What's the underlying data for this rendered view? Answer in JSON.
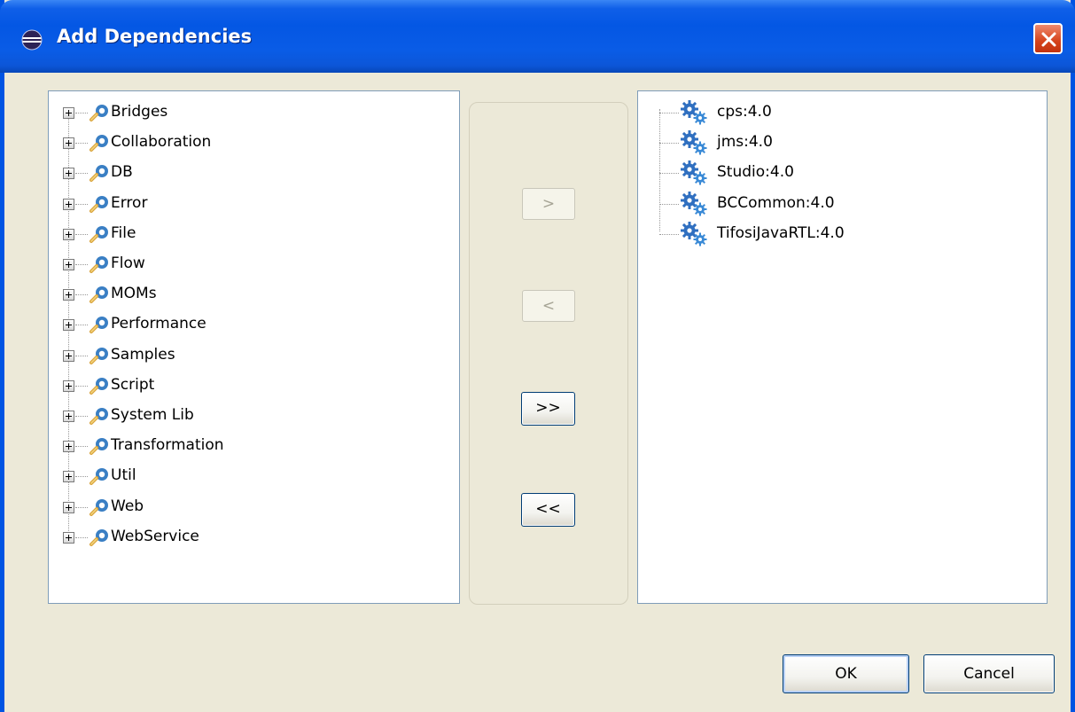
{
  "window": {
    "title": "Add Dependencies"
  },
  "left_tree": {
    "items": [
      {
        "label": "Bridges"
      },
      {
        "label": "Collaboration"
      },
      {
        "label": "DB"
      },
      {
        "label": "Error"
      },
      {
        "label": "File"
      },
      {
        "label": "Flow"
      },
      {
        "label": "MOMs"
      },
      {
        "label": "Performance"
      },
      {
        "label": "Samples"
      },
      {
        "label": "Script"
      },
      {
        "label": "System Lib"
      },
      {
        "label": "Transformation"
      },
      {
        "label": "Util"
      },
      {
        "label": "Web"
      },
      {
        "label": "WebService"
      }
    ],
    "icon": "package-icon"
  },
  "right_tree": {
    "items": [
      {
        "label": "cps:4.0"
      },
      {
        "label": "jms:4.0"
      },
      {
        "label": "Studio:4.0"
      },
      {
        "label": "BCCommon:4.0"
      },
      {
        "label": "TifosiJavaRTL:4.0"
      }
    ],
    "icon": "gear-icon"
  },
  "transfer_buttons": {
    "add": ">",
    "remove": "<",
    "add_all": ">>",
    "remove_all": "<<"
  },
  "footer": {
    "ok": "OK",
    "cancel": "Cancel"
  },
  "colors": {
    "titlebar": "#0457e4",
    "window_bg": "#ece9d8",
    "close": "#d5431b"
  }
}
